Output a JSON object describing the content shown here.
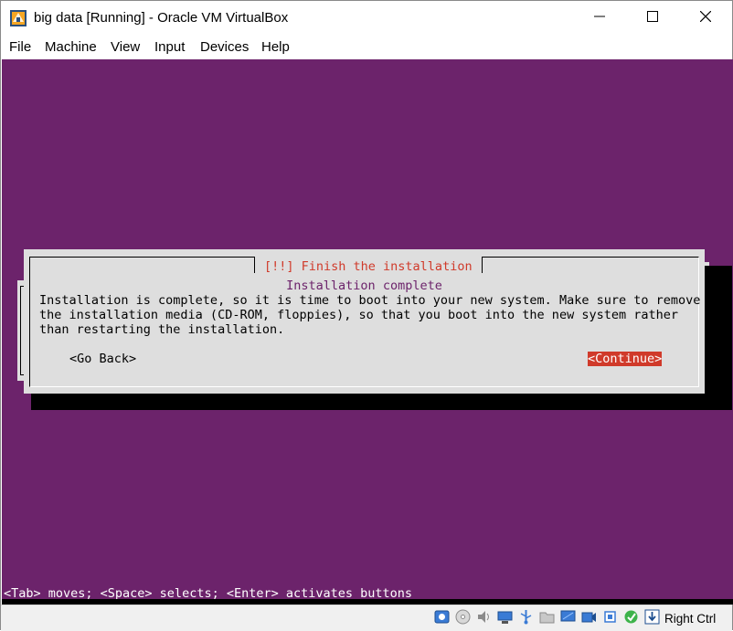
{
  "window": {
    "title": "big data [Running] - Oracle VM VirtualBox"
  },
  "menu": {
    "items": [
      "File",
      "Machine",
      "View",
      "Input",
      "Devices",
      "Help"
    ]
  },
  "installer": {
    "dialog_title": "[!!] Finish the installation",
    "subtitle": "Installation complete",
    "message": "Installation is complete, so it is time to boot into your new system. Make sure to remove\nthe installation media (CD-ROM, floppies), so that you boot into the new system rather\nthan restarting the installation.",
    "go_back_label": "<Go Back>",
    "continue_label": "<Continue>",
    "help_line": "<Tab> moves; <Space> selects; <Enter> activates buttons"
  },
  "statusbar": {
    "host_key": "Right Ctrl",
    "icons": [
      "hard-disk-icon",
      "optical-drive-icon",
      "audio-icon",
      "network-icon",
      "usb-icon",
      "shared-folders-icon",
      "display-icon",
      "video-capture-icon",
      "cpu-icon",
      "mouse-integration-icon",
      "keyboard-capture-icon"
    ]
  },
  "colors": {
    "vm_background": "#6c236b",
    "dialog_background": "#dedede",
    "accent_red": "#d03a2a"
  }
}
